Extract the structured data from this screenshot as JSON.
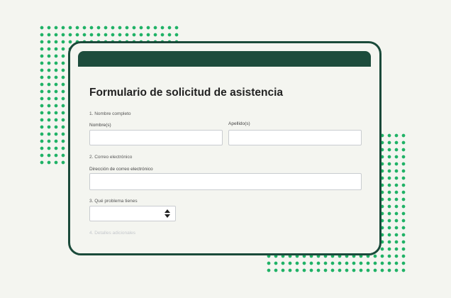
{
  "form": {
    "title": "Formulario de solicitud de asistencia",
    "questions": [
      {
        "label": "1. Nombre completo",
        "fields": [
          {
            "label": "Nombre(s)",
            "value": ""
          },
          {
            "label": "Apellido(s)",
            "value": ""
          }
        ]
      },
      {
        "label": "2. Correo electrónico",
        "fields": [
          {
            "label": "Dirección de correo electrónico",
            "value": ""
          }
        ]
      },
      {
        "label": "3. Qué problema tienes",
        "select_value": ""
      },
      {
        "label": "4. Detalles adicionales"
      }
    ]
  },
  "colors": {
    "accent_dark_green": "#1d4c3c",
    "dot_green": "#1fb266",
    "background": "#f4f5f0"
  },
  "icons": {
    "select_arrows": "up-down-arrows-icon"
  }
}
